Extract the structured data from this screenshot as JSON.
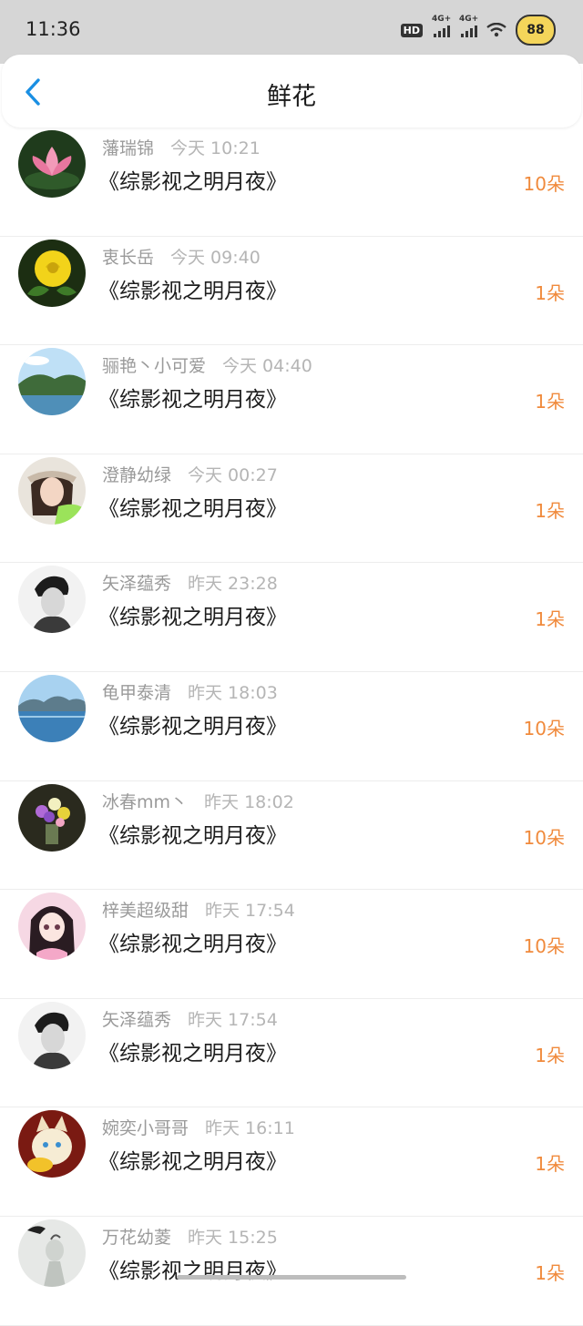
{
  "status_bar": {
    "time": "11:36",
    "hd_label": "HD",
    "signal1_label": "4G+",
    "signal2_label": "4G+",
    "battery": "88"
  },
  "header": {
    "title": "鲜花",
    "back_icon": "chevron-left-icon"
  },
  "colors": {
    "accent": "#1a8fe3",
    "count": "#f08a3c"
  },
  "items": [
    {
      "user": "藩瑞锦",
      "time": "今天 10:21",
      "book": "《综影视之明月夜》",
      "count": "10朵",
      "avatar": "lotus"
    },
    {
      "user": "衷长岳",
      "time": "今天 09:40",
      "book": "《综影视之明月夜》",
      "count": "1朵",
      "avatar": "rose"
    },
    {
      "user": "骊艳丶小可爱",
      "time": "今天 04:40",
      "book": "《综影视之明月夜》",
      "count": "1朵",
      "avatar": "landscape"
    },
    {
      "user": "澄静幼绿",
      "time": "今天 00:27",
      "book": "《综影视之明月夜》",
      "count": "1朵",
      "avatar": "girl"
    },
    {
      "user": "矢泽蕴秀",
      "time": "昨天 23:28",
      "book": "《综影视之明月夜》",
      "count": "1朵",
      "avatar": "bw-portrait"
    },
    {
      "user": "龟甲泰清",
      "time": "昨天 18:03",
      "book": "《综影视之明月夜》",
      "count": "10朵",
      "avatar": "lake"
    },
    {
      "user": "冰春mm丶",
      "time": "昨天 18:02",
      "book": "《综影视之明月夜》",
      "count": "10朵",
      "avatar": "flowers"
    },
    {
      "user": "梓美超级甜",
      "time": "昨天 17:54",
      "book": "《综影视之明月夜》",
      "count": "10朵",
      "avatar": "anime"
    },
    {
      "user": "矢泽蕴秀",
      "time": "昨天 17:54",
      "book": "《综影视之明月夜》",
      "count": "1朵",
      "avatar": "bw-portrait"
    },
    {
      "user": "婉奕小哥哥",
      "time": "昨天 16:11",
      "book": "《综影视之明月夜》",
      "count": "1朵",
      "avatar": "cat"
    },
    {
      "user": "万花幼菱",
      "time": "昨天 15:25",
      "book": "《综影视之明月夜》",
      "count": "1朵",
      "avatar": "sketch"
    }
  ]
}
